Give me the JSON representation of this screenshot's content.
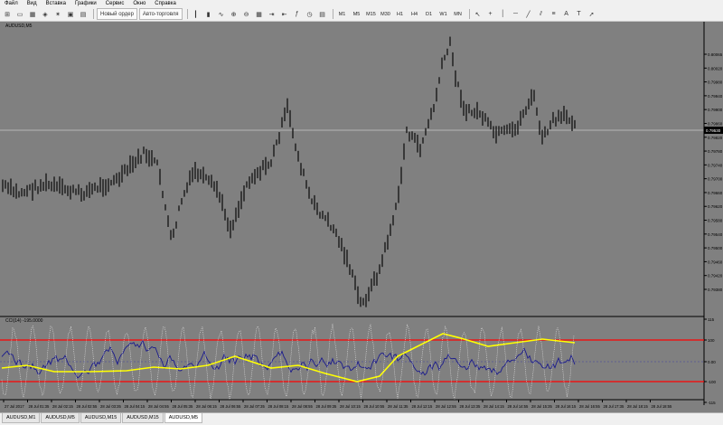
{
  "menu": [
    "Файл",
    "Вид",
    "Вставка",
    "Графики",
    "Сервис",
    "Окно",
    "Справка"
  ],
  "toolbar": {
    "new_order_label": "Новый ордер",
    "autotrading_label": "Авто-торговля",
    "timeframes": [
      "M1",
      "M5",
      "M15",
      "M30",
      "H1",
      "H4",
      "D1",
      "W1",
      "MN"
    ]
  },
  "chart": {
    "title": "AUDUSD,M5",
    "indicator_title": "CCI(14) -195.0000",
    "current_price": "0.79530",
    "price_ticks": [
      "0.80065",
      "0.80020",
      "0.79980",
      "0.79940",
      "0.79900",
      "0.79860",
      "0.79820",
      "0.79780",
      "0.79740",
      "0.79700",
      "0.79660",
      "0.79620",
      "0.79580",
      "0.79540",
      "0.79500",
      "0.79460",
      "0.79420",
      "0.79380"
    ],
    "ind_ticks": [
      "115",
      "100",
      "0.00",
      "-100",
      "-115"
    ],
    "time_ticks": [
      "27 Jul 2017",
      "28 Jul 01:35",
      "28 Jul 02:15",
      "28 Jul 02:55",
      "28 Jul 03:35",
      "28 Jul 04:15",
      "28 Jul 04:55",
      "28 Jul 05:35",
      "28 Jul 06:15",
      "28 Jul 06:55",
      "28 Jul 07:35",
      "28 Jul 08:15",
      "28 Jul 08:55",
      "28 Jul 09:35",
      "28 Jul 10:15",
      "28 Jul 10:55",
      "28 Jul 11:35",
      "28 Jul 12:15",
      "28 Jul 12:55",
      "28 Jul 13:35",
      "28 Jul 14:15",
      "28 Jul 14:55",
      "28 Jul 15:35",
      "28 Jul 16:15",
      "28 Jul 16:55",
      "28 Jul 17:35",
      "28 Jul 18:15",
      "28 Jul 18:55"
    ],
    "colors": {
      "background": "#808080",
      "candle": "#1a1a1a",
      "level_line": "#ff0000",
      "ma_line": "#ffff00",
      "cci_line": "#1a1a8c",
      "dots": "#e6e6e6"
    }
  },
  "tabs": [
    "AUDUSD,M1",
    "AUDUSD,M5",
    "AUDUSD,M15",
    "AUDUSD,M15",
    "AUDUSD,M5"
  ],
  "active_tab": 4
}
